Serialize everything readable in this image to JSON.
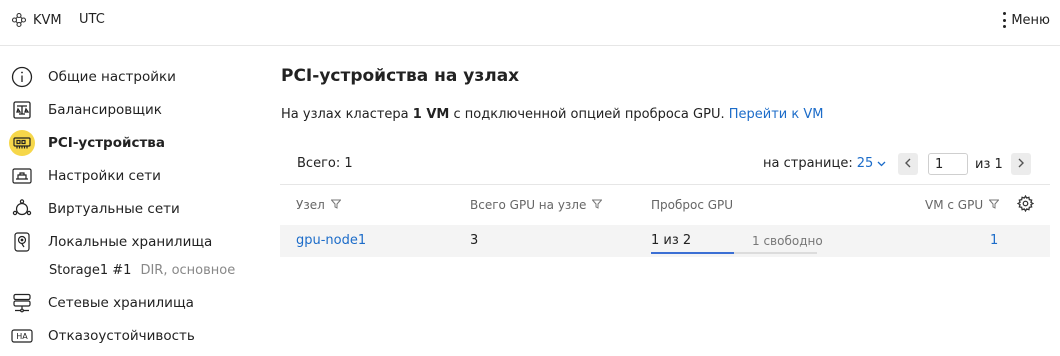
{
  "header": {
    "brand_icon": "cluster-nodes-icon",
    "brand_name": "KVM",
    "timezone": "UTC",
    "menu_label": "Меню"
  },
  "sidebar": {
    "items": [
      {
        "label": "Общие настройки",
        "icon": "info-circle-icon"
      },
      {
        "label": "Балансировщик",
        "icon": "balancer-icon"
      },
      {
        "label": "PCI-устройства",
        "icon": "pci-card-icon",
        "active": true
      },
      {
        "label": "Настройки сети",
        "icon": "network-settings-icon"
      },
      {
        "label": "Виртуальные сети",
        "icon": "virtual-network-icon"
      },
      {
        "label": "Локальные хранилища",
        "icon": "local-storage-icon"
      },
      {
        "label": "Сетевые хранилища",
        "icon": "network-storage-icon"
      },
      {
        "label": "Отказоустойчивость",
        "icon": "ha-icon"
      }
    ],
    "storage_sub": {
      "name": "Storage1 #1",
      "meta": "DIR, основное"
    }
  },
  "main": {
    "title": "PCI-устройства на узлах",
    "info_prefix": "На узлах кластера ",
    "info_bold": "1 VM",
    "info_suffix": " с подключенной опцией проброса GPU. ",
    "info_link": "Перейти к VM",
    "total": "Всего: 1",
    "per_page_label": "на странице:",
    "per_page_value": "25",
    "page_value": "1",
    "page_of": "из 1",
    "columns": {
      "node": "Узел",
      "gpu_total": "Всего GPU на узле",
      "passthrough": "Проброс GPU",
      "vm_gpu": "VM с GPU"
    },
    "rows": [
      {
        "node": "gpu-node1",
        "gpu_total": "3",
        "passthrough": "1 из 2",
        "free": "1 свободно",
        "passthrough_fraction": 0.5,
        "vm_gpu": "1"
      }
    ]
  },
  "colors": {
    "accent": "#1c6cc9",
    "active_highlight": "#f6d74a",
    "progress_fill": "#3b6fd4"
  }
}
